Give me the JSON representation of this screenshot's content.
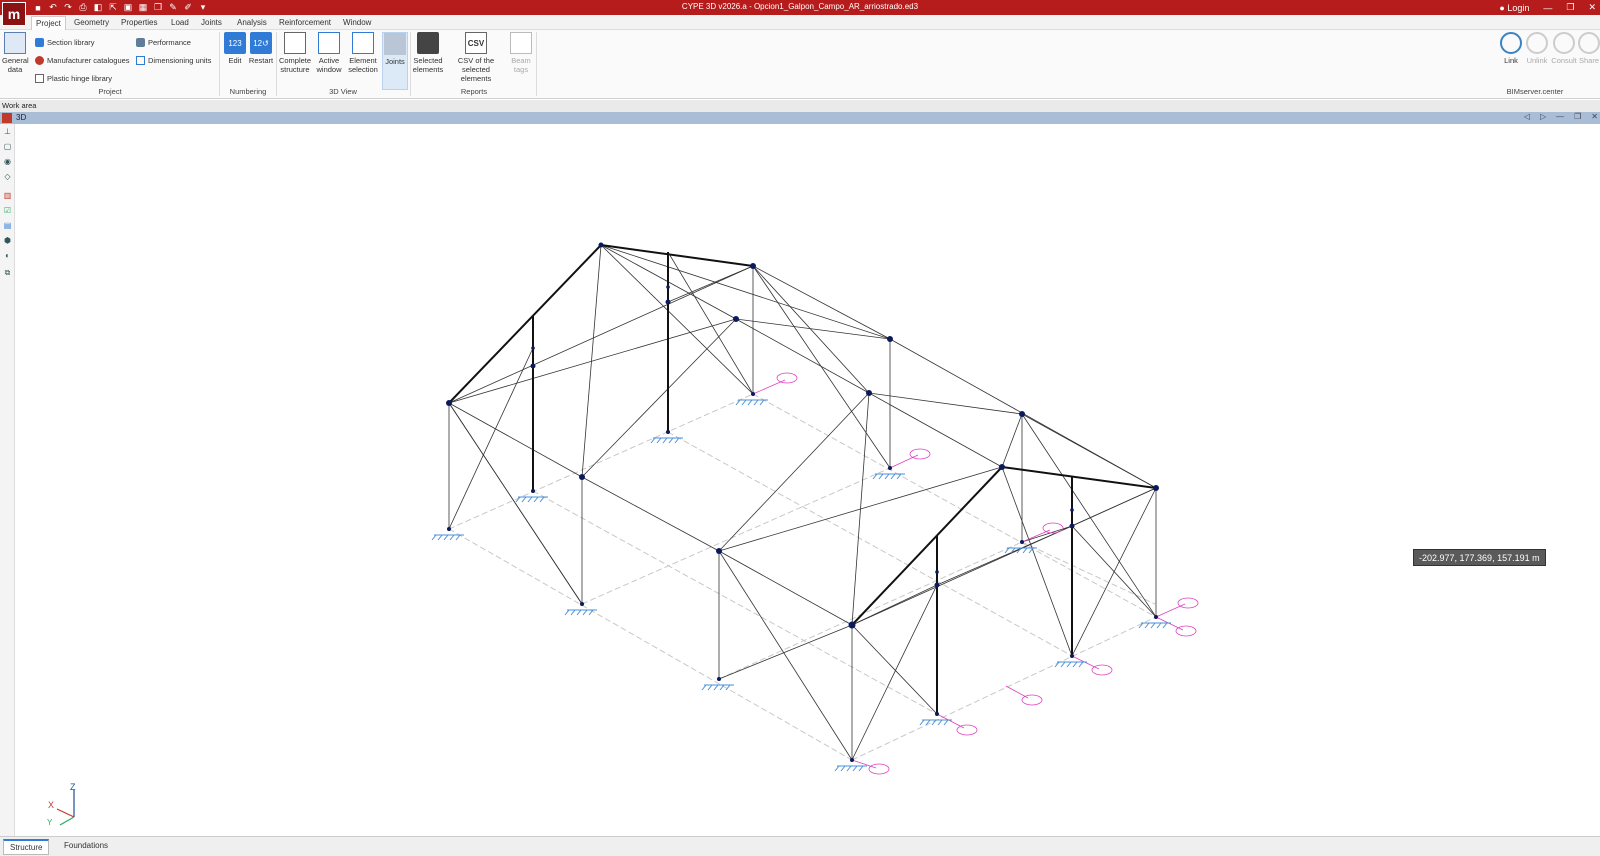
{
  "window": {
    "title": "CYPE 3D v2026.a - Opcion1_Galpon_Campo_AR_arriostrado.ed3",
    "login": "Login"
  },
  "menu": [
    "Project",
    "Geometry",
    "Properties",
    "Load",
    "Joints",
    "Analysis",
    "Reinforcement",
    "Window"
  ],
  "ribbon": {
    "project": {
      "general_data": "General data",
      "section_library": "Section library",
      "manufacturer_catalogues": "Manufacturer catalogues",
      "plastic_hinge_library": "Plastic hinge library",
      "performance": "Performance",
      "dimensioning_units": "Dimensioning units",
      "label": "Project"
    },
    "numbering": {
      "edit": "Edit",
      "restart": "Restart",
      "label": "Numbering"
    },
    "view3d": {
      "complete_structure": "Complete structure",
      "active_window": "Active window",
      "element_selection": "Element selection",
      "joints": "Joints",
      "label": "3D View"
    },
    "reports": {
      "selected_elements": "Selected elements",
      "csv_selected": "CSV of the selected elements",
      "beam_tags": "Beam tags",
      "label": "Reports"
    },
    "bimserver": {
      "link": "Link",
      "unlink": "Unlink",
      "consult": "Consult",
      "share": "Share",
      "label": "BIMserver.center"
    }
  },
  "workarea": {
    "label": "Work area",
    "view_title": "3D"
  },
  "viewport": {
    "coordinates": "-202.977, 177.369, 157.191 m",
    "axes": {
      "x": "X",
      "y": "Y",
      "z": "Z"
    }
  },
  "bottom_tabs": [
    "Structure",
    "Foundations"
  ],
  "colors": {
    "titlebar": "#b71c1c",
    "accent": "#2f7bd6",
    "support": "#4a8fd8",
    "gridline_label": "#e040c0"
  },
  "icons": [
    "save-icon",
    "undo-icon",
    "redo-icon",
    "print-icon",
    "zoom-icon",
    "pan-icon",
    "close-icon",
    "minimize-icon",
    "maximize-icon"
  ]
}
